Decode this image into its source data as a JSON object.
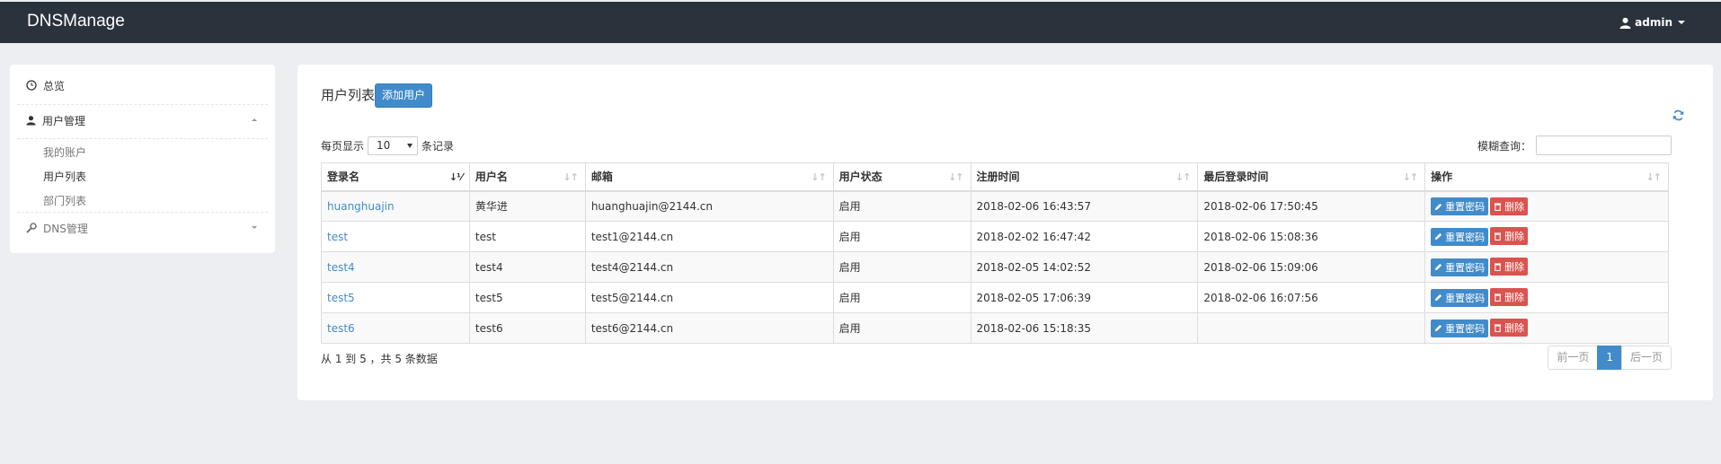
{
  "app": {
    "title": "DNSManage",
    "user": "admin"
  },
  "sidebar": {
    "overview": "总览",
    "user_mgmt": "用户管理",
    "sub_items": [
      "我的账户",
      "用户列表",
      "部门列表"
    ],
    "dns_mgmt": "DNS管理"
  },
  "panel": {
    "title": "用户列表",
    "add_button": "添加用户",
    "length_prefix": "每页显示",
    "length_value": "10",
    "length_suffix": "条记录",
    "filter_label": "模糊查询："
  },
  "table": {
    "headers": [
      "登录名",
      "用户名",
      "邮箱",
      "用户状态",
      "注册时间",
      "最后登录时间",
      "操作"
    ],
    "rows": [
      {
        "login": "huanghuajin",
        "name": "黄华进",
        "email": "huanghuajin@2144.cn",
        "status": "启用",
        "registered": "2018-02-06 16:43:57",
        "last_login": "2018-02-06 17:50:45"
      },
      {
        "login": "test",
        "name": "test",
        "email": "test1@2144.cn",
        "status": "启用",
        "registered": "2018-02-02 16:47:42",
        "last_login": "2018-02-06 15:08:36"
      },
      {
        "login": "test4",
        "name": "test4",
        "email": "test4@2144.cn",
        "status": "启用",
        "registered": "2018-02-05 14:02:52",
        "last_login": "2018-02-06 15:09:06"
      },
      {
        "login": "test5",
        "name": "test5",
        "email": "test5@2144.cn",
        "status": "启用",
        "registered": "2018-02-05 17:06:39",
        "last_login": "2018-02-06 16:07:56"
      },
      {
        "login": "test6",
        "name": "test6",
        "email": "test6@2144.cn",
        "status": "启用",
        "registered": "2018-02-06 15:18:35",
        "last_login": ""
      }
    ],
    "reset_label": "重置密码",
    "delete_label": "删除"
  },
  "footer": {
    "info": "从 1 到 5 ，共 5 条数据",
    "prev": "前一页",
    "page": "1",
    "next": "后一页"
  },
  "colors": {
    "topbar": "#2a323c",
    "primary": "#428bca",
    "danger": "#d9534f"
  }
}
